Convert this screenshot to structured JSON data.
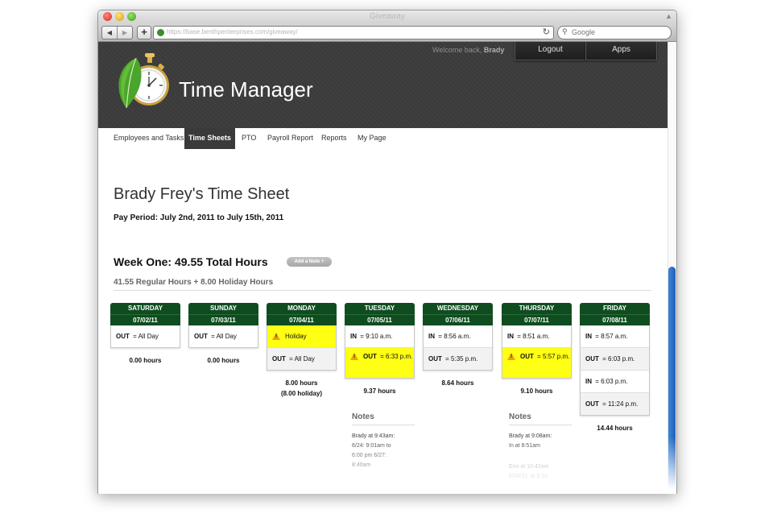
{
  "browser": {
    "window_title": "Giveaway",
    "url": "https://base.benthpenterprises.com/giveaway/",
    "search_placeholder": "Google",
    "back_glyph": "◀",
    "forward_glyph": "▶",
    "add_glyph": "+",
    "reload_glyph": "↻"
  },
  "header": {
    "welcome_prefix": "Welcome back,",
    "welcome_user": "Brady",
    "logout_label": "Logout",
    "apps_label": "Apps",
    "app_title": "Time Manager",
    "logo_icon": "stopwatch-leaf-icon"
  },
  "nav": {
    "items": [
      {
        "label": "Employees and Tasks"
      },
      {
        "label": "Time Sheets",
        "active": true
      },
      {
        "label": "PTO"
      },
      {
        "label": "Payroll Report"
      },
      {
        "label": "Reports"
      },
      {
        "label": "My Page"
      }
    ]
  },
  "sheet": {
    "title": "Brady Frey's Time Sheet",
    "pay_period": "Pay Period: July 2nd, 2011 to July 15th, 2011",
    "week_title": "Week One: 49.55 Total Hours",
    "add_note_label": "Add a Note +",
    "hours_summary": "41.55 Regular Hours + 8.00 Holiday Hours"
  },
  "days": [
    {
      "name": "SATURDAY",
      "date": "07/02/11",
      "entries": [
        {
          "kind": "OUT",
          "value": "All Day"
        }
      ],
      "total": "0.00 hours"
    },
    {
      "name": "SUNDAY",
      "date": "07/03/11",
      "entries": [
        {
          "kind": "OUT",
          "value": "All Day"
        }
      ],
      "total": "0.00 hours"
    },
    {
      "name": "MONDAY",
      "date": "07/04/11",
      "entries": [
        {
          "kind": "WARN",
          "value": "Holiday"
        },
        {
          "kind": "OUT",
          "value": "All Day"
        }
      ],
      "total": "8.00 hours",
      "total_sub": "(8.00 holiday)"
    },
    {
      "name": "TUESDAY",
      "date": "07/05/11",
      "entries": [
        {
          "kind": "IN",
          "value": "9:10 a.m."
        },
        {
          "kind": "OUT",
          "value": "6:33 p.m.",
          "warn": true
        }
      ],
      "total": "9.37 hours"
    },
    {
      "name": "WEDNESDAY",
      "date": "07/06/11",
      "entries": [
        {
          "kind": "IN",
          "value": "8:56 a.m."
        },
        {
          "kind": "OUT",
          "value": "5:35 p.m."
        }
      ],
      "total": "8.64 hours"
    },
    {
      "name": "THURSDAY",
      "date": "07/07/11",
      "entries": [
        {
          "kind": "IN",
          "value": "8:51 a.m."
        },
        {
          "kind": "OUT",
          "value": "5:57 p.m.",
          "warn": true
        }
      ],
      "total": "9.10 hours"
    },
    {
      "name": "FRIDAY",
      "date": "07/08/11",
      "entries": [
        {
          "kind": "IN",
          "value": "8:57 a.m."
        },
        {
          "kind": "OUT",
          "value": "6:03 p.m."
        },
        {
          "kind": "IN",
          "value": "6:03 p.m."
        },
        {
          "kind": "OUT",
          "value": "11:24 p.m."
        }
      ],
      "total": "14.44 hours"
    }
  ],
  "notes": [
    {
      "day_index": 3,
      "label": "Notes",
      "author": "Brady at 9:43am:",
      "lines": [
        "6/24: 9:01am to",
        "6:00 pm 6/27:",
        "8:40am"
      ]
    },
    {
      "day_index": 5,
      "label": "Notes",
      "author": "Brady at 9:08am:",
      "lines": [
        "In at 8:51am"
      ],
      "more": [
        "Erin at 10:42am",
        "6/24/11, at 8:10"
      ]
    }
  ]
}
